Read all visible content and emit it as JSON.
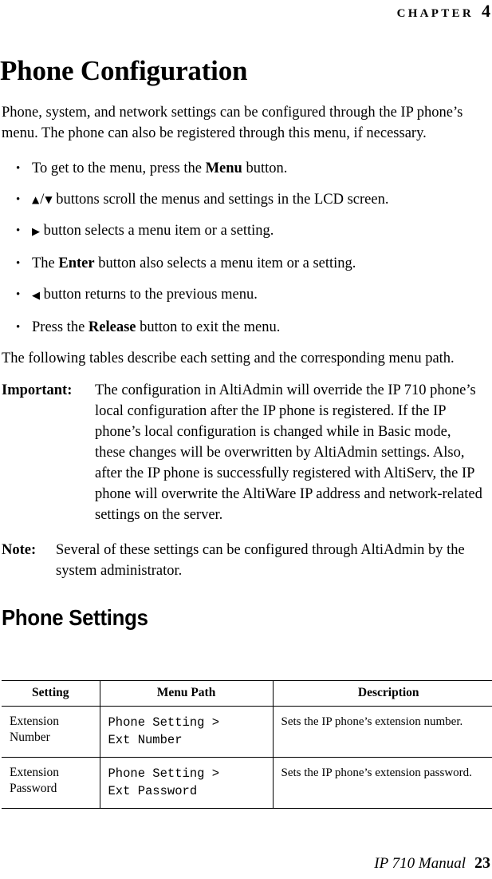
{
  "header": {
    "chapter_word": "CHAPTER",
    "chapter_number": "4"
  },
  "title": "Phone Configuration",
  "intro": {
    "paragraph": "Phone, system, and network settings can be configured through the IP phone’s menu. The phone can also be registered through this menu, if necessary."
  },
  "bullets": [
    {
      "bullet": "•",
      "pre": "To get to the menu, press the ",
      "strong": "Menu",
      "post": " button."
    },
    {
      "bullet": "•",
      "glyph_up": "▲",
      "glyph_slash": "/",
      "glyph_down": "▼",
      "post": " buttons scroll the menus and settings in the LCD screen."
    },
    {
      "bullet": "•",
      "glyph_right": "▶",
      "post": " button selects a menu item or a setting."
    },
    {
      "bullet": "•",
      "pre": "The ",
      "strong": "Enter",
      "post": " button also selects a menu item or a setting."
    },
    {
      "bullet": "•",
      "glyph_left": "◀",
      "post": " button returns to the previous menu."
    },
    {
      "bullet": "•",
      "pre": "Press the ",
      "strong": "Release",
      "post": " button to exit the menu."
    }
  ],
  "tables_intro": "The following tables describe each setting and the corresponding menu path.",
  "important": {
    "label": "Important:",
    "text": "The configuration in AltiAdmin will override the IP 710 phone’s local configuration after the IP phone is registered. If the IP phone’s local configuration is changed while in Basic mode, these changes will be overwritten by AltiAdmin settings. Also, after the IP phone is successfully registered with AltiServ, the IP phone will overwrite the AltiWare IP address and network-related settings on the server."
  },
  "note": {
    "label": "Note:",
    "text": "Several of these settings can be configured through AltiAdmin by the system administrator."
  },
  "section_heading": "Phone Settings",
  "table": {
    "headers": [
      "Setting",
      "Menu Path",
      "Description"
    ],
    "rows": [
      {
        "setting": "Extension Number",
        "menu_path": "Phone Setting >\nExt Number",
        "description": "Sets the IP phone’s extension number."
      },
      {
        "setting": "Extension Password",
        "menu_path": "Phone Setting >\nExt Password",
        "description": "Sets the IP phone’s extension password."
      }
    ]
  },
  "footer": {
    "manual": "IP 710 Manual",
    "page_number": "23"
  }
}
